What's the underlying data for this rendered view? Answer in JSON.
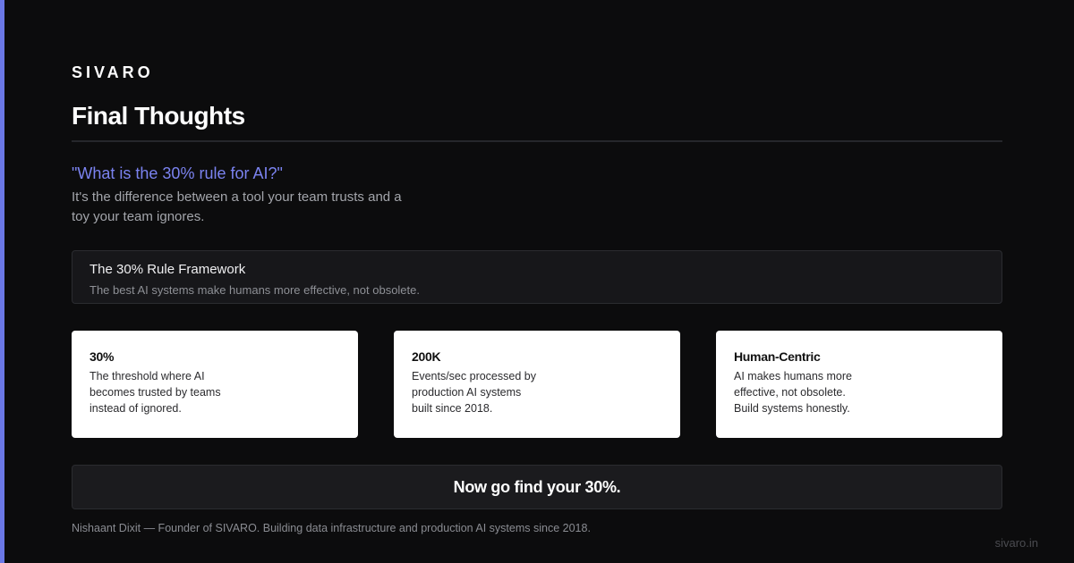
{
  "brand": "SIVARO",
  "title": "Final Thoughts",
  "question": "\"What is the 30% rule for AI?\"",
  "answer": "It's the difference between a tool your team trusts and a toy your team ignores.",
  "framework": {
    "title": "The 30% Rule Framework",
    "subtitle": "The best AI systems make humans more effective, not obsolete."
  },
  "cards": [
    {
      "title": "30%",
      "description": "The threshold where AI\nbecomes trusted by teams\ninstead of ignored."
    },
    {
      "title": "200K",
      "description": "Events/sec processed by\nproduction AI systems\nbuilt since 2018."
    },
    {
      "title": "Human-Centric",
      "description": "AI makes humans more\neffective, not obsolete.\nBuild systems honestly."
    }
  ],
  "cta": "Now go find your 30%.",
  "footer": "Nishaant Dixit — Founder of SIVARO. Building data infrastructure and production AI systems since 2018.",
  "site": "sivaro.in",
  "colors": {
    "accent": "#6b78e6",
    "background": "#0c0c0d",
    "question": "#7b83f0"
  }
}
